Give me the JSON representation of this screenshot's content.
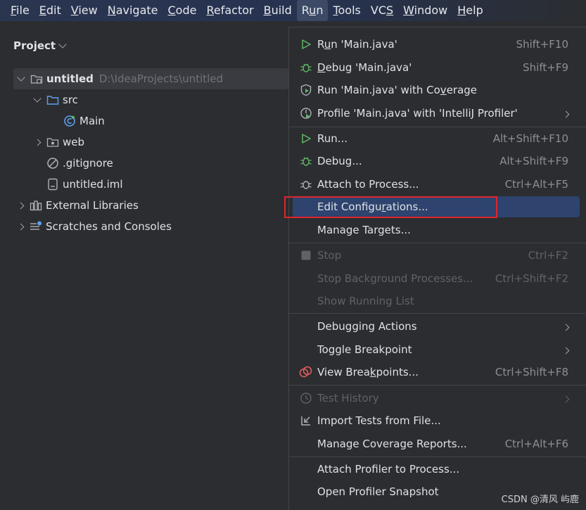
{
  "menubar": {
    "items": [
      {
        "pre": "",
        "u": "F",
        "post": "ile"
      },
      {
        "pre": "",
        "u": "E",
        "post": "dit"
      },
      {
        "pre": "",
        "u": "V",
        "post": "iew"
      },
      {
        "pre": "",
        "u": "N",
        "post": "avigate"
      },
      {
        "pre": "",
        "u": "C",
        "post": "ode"
      },
      {
        "pre": "",
        "u": "R",
        "post": "efactor"
      },
      {
        "pre": "",
        "u": "B",
        "post": "uild"
      },
      {
        "pre": "R",
        "u": "u",
        "post": "n"
      },
      {
        "pre": "",
        "u": "T",
        "post": "ools"
      },
      {
        "pre": "VC",
        "u": "S",
        "post": ""
      },
      {
        "pre": "",
        "u": "W",
        "post": "indow"
      },
      {
        "pre": "",
        "u": "H",
        "post": "elp"
      }
    ]
  },
  "project": {
    "title": "Project",
    "tree": [
      {
        "label": "untitled",
        "path": "D:\\IdeaProjects\\untitled"
      },
      {
        "label": "src"
      },
      {
        "label": "Main"
      },
      {
        "label": "web"
      },
      {
        "label": ".gitignore"
      },
      {
        "label": "untitled.iml"
      },
      {
        "label": "External Libraries"
      },
      {
        "label": "Scratches and Consoles"
      }
    ]
  },
  "run_menu": {
    "items": [
      {
        "pre": "R",
        "u": "u",
        "post": "n 'Main.java'",
        "shortcut": "Shift+F10"
      },
      {
        "pre": "",
        "u": "D",
        "post": "ebug 'Main.java'",
        "shortcut": "Shift+F9"
      },
      {
        "pre": "Run 'Main.java' with Co",
        "u": "v",
        "post": "erage",
        "shortcut": ""
      },
      {
        "pre": "Profile 'Main.java' with 'IntelliJ Profiler'",
        "u": "",
        "post": "",
        "shortcut": ""
      },
      {
        "pre": "Run...",
        "u": "",
        "post": "",
        "shortcut": "Alt+Shift+F10"
      },
      {
        "pre": "Debug...",
        "u": "",
        "post": "",
        "shortcut": "Alt+Shift+F9"
      },
      {
        "pre": "Attach to Process...",
        "u": "",
        "post": "",
        "shortcut": "Ctrl+Alt+F5"
      },
      {
        "pre": "Edit Configu",
        "u": "r",
        "post": "ations...",
        "shortcut": ""
      },
      {
        "pre": "Manage Targets...",
        "u": "",
        "post": "",
        "shortcut": ""
      },
      {
        "pre": "Stop",
        "u": "",
        "post": "",
        "shortcut": "Ctrl+F2"
      },
      {
        "pre": "Stop Background Processes...",
        "u": "",
        "post": "",
        "shortcut": "Ctrl+Shift+F2"
      },
      {
        "pre": "Show Running List",
        "u": "",
        "post": "",
        "shortcut": ""
      },
      {
        "pre": "Debugging Actions",
        "u": "",
        "post": "",
        "shortcut": ""
      },
      {
        "pre": "Toggle Breakpoint",
        "u": "",
        "post": "",
        "shortcut": ""
      },
      {
        "pre": "View Brea",
        "u": "k",
        "post": "points...",
        "shortcut": "Ctrl+Shift+F8"
      },
      {
        "pre": "Test History",
        "u": "",
        "post": "",
        "shortcut": ""
      },
      {
        "pre": "Import Tests from File...",
        "u": "",
        "post": "",
        "shortcut": ""
      },
      {
        "pre": "Manage Coverage Reports...",
        "u": "",
        "post": "",
        "shortcut": "Ctrl+Alt+F6"
      },
      {
        "pre": "Attach Profiler to Process...",
        "u": "",
        "post": "",
        "shortcut": ""
      },
      {
        "pre": "Open Profiler Snapshot",
        "u": "",
        "post": "",
        "shortcut": ""
      }
    ]
  },
  "watermark": "CSDN @清风 屿鹿"
}
